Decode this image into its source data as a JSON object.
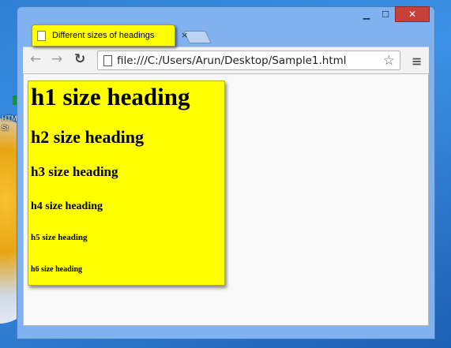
{
  "desktop": {
    "icon_label_1": "HTM",
    "icon_label_2": "St"
  },
  "window": {
    "minimize_label": "▁",
    "maximize_label": "☐",
    "close_label": "✕"
  },
  "tab": {
    "title": "Different sizes of headings",
    "close_label": "×"
  },
  "toolbar": {
    "back_label": "←",
    "forward_label": "→",
    "reload_label": "↻",
    "url": "file:///C:/Users/Arun/Desktop/Sample1.html",
    "star_label": "☆",
    "menu_label": "≡"
  },
  "content": {
    "h1": "h1 size heading",
    "h2": "h2 size heading",
    "h3": "h3 size heading",
    "h4": "h4 size heading",
    "h5": "h5 size heading",
    "h6": "h6 size heading"
  },
  "colors": {
    "highlight": "#ffff00",
    "close_button": "#c7403a",
    "window_frame": "#7fb2ef"
  }
}
